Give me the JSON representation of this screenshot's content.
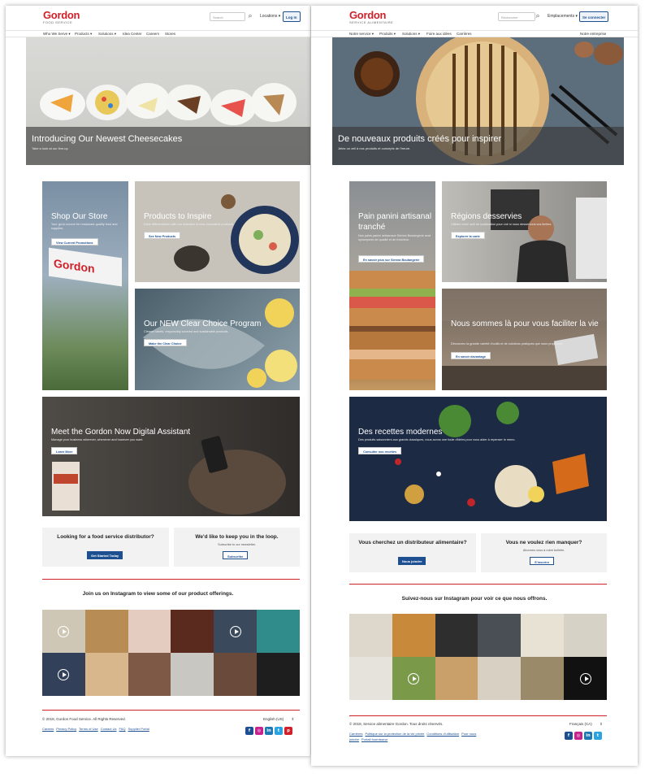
{
  "en": {
    "logo": {
      "main": "Gordon",
      "sub": "FOOD SERVICE"
    },
    "search": {
      "placeholder": "Search"
    },
    "locations": "Locations ▾",
    "login": "Log In",
    "nav": [
      "Who We Serve ▾",
      "Products ▾",
      "Solutions ▾",
      "Idea Center",
      "Careers",
      "Stores"
    ],
    "hero": {
      "title": "Introducing Our Newest Cheesecakes",
      "sub": "Take a look at our line-up"
    },
    "tiles": [
      {
        "title": "Shop Our Store",
        "text": "Your go-to source for restaurant-quality food and supplies.",
        "button": "View Current Promotions"
      },
      {
        "title": "Products to Inspire",
        "text": "Drive differentiation with our selection of new, innovative products.",
        "button": "See New Products"
      },
      {
        "title": "Our NEW Clear Choice Program",
        "text": "Cleaner labels, responsibly sourced and sustainable products.",
        "button": "Make the Clear Choice"
      },
      {
        "title": "Meet the Gordon Now Digital Assistant",
        "text": "Manage your business wherever, whenever and however you want.",
        "button": "Learn More"
      }
    ],
    "cta": [
      {
        "title": "Looking for a food service distributor?",
        "sub": "",
        "button": "Get Started Today"
      },
      {
        "title": "We'd like to keep you in the loop.",
        "sub": "Subscribe to our newsletter.",
        "button": "Subscribe"
      }
    ],
    "insta_heading": "Join us on Instagram to view some of our product offerings.",
    "copyright": "© 2018, Gordon Food Service. All Rights Reserved.",
    "language": "English (US)",
    "footer_links": [
      "Careers",
      "Privacy Policy",
      "Terms of Use",
      "Contact Us",
      "FAQ",
      "Supplier Portal"
    ]
  },
  "fr": {
    "logo": {
      "main": "Gordon",
      "sub": "SERVICE ALIMENTAIRE"
    },
    "search": {
      "placeholder": "Rechercher"
    },
    "locations": "Emplacements ▾",
    "login": "Se connecter",
    "nav": [
      "Notre service ▾",
      "Produits ▾",
      "Solutions ▾",
      "Foire aux idées",
      "Carrières"
    ],
    "nav_right": "Notre entreprise",
    "hero": {
      "title": "De nouveaux produits créés pour inspirer",
      "sub": "Jetez un œil à nos produits et concepts de l'heure."
    },
    "tiles": [
      {
        "title": "Pain panini artisanal tranché",
        "text": "Nos pains panini artisanaux Sienna Boulangerie sont synonymes de qualité et de fraîcheur.",
        "button": "En savoir plus sur Sienna Boulangerie"
      },
      {
        "title": "Régions desservies",
        "text": "Utilisez notre outil de localisation pour voir si nous desservons vos limites.",
        "button": "Explorer la carte"
      },
      {
        "title": "Nous sommes là pour vous faciliter la vie",
        "text": "Découvrez la grande variété d'outils et de solutions pratiques que nous proposons.",
        "button": "En savoir davantage"
      },
      {
        "title": "Des recettes modernes",
        "text": "Des produits saisonniers aux grands classiques, nous avons une foule d'idées pour vous aider à repenser le menu.",
        "button": "Consulter nos recettes"
      }
    ],
    "cta": [
      {
        "title": "Vous cherchez un distributeur alimentaire?",
        "sub": "",
        "button": "Nous joindre"
      },
      {
        "title": "Vous ne voulez rien manquer?",
        "sub": "Abonnez-vous à notre bulletin.",
        "button": "S'inscrire"
      }
    ],
    "insta_heading": "Suivez-nous sur Instagram pour voir ce que nous offrons.",
    "copyright": "© 2018, Service alimentaire Gordon. Tous droits réservés.",
    "language": "Français (CA)",
    "footer_links": [
      "Carrières",
      "Politique sur la protection de la vie privée",
      "Conditions d'utilisation",
      "Pour nous joindre",
      "Portail fournisseur"
    ]
  },
  "icons": {
    "search": "search-icon",
    "language": "updown-icon",
    "socials": [
      "facebook-icon",
      "instagram-icon",
      "linkedin-icon",
      "twitter-icon",
      "pinterest-icon"
    ]
  },
  "colors": {
    "brand_red": "#d0212a",
    "brand_blue": "#1d4f91"
  }
}
